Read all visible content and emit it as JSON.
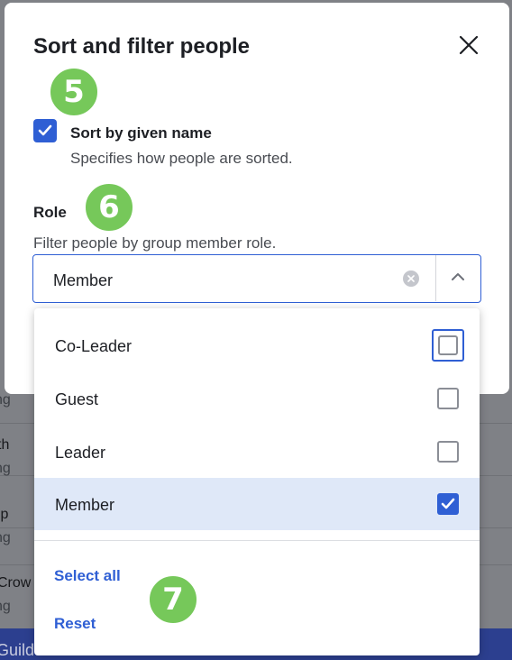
{
  "background": {
    "rows": [
      {
        "text": "ng",
        "sub": ""
      },
      {
        "text": "th",
        "sub": "ng"
      },
      {
        "text": "ip",
        "sub": "ng"
      },
      {
        "text": "Crow",
        "sub": "ng"
      }
    ],
    "footer_text": "Guild Crue"
  },
  "modal": {
    "title": "Sort and filter people",
    "sort": {
      "label": "Sort by given name",
      "help": "Specifies how people are sorted.",
      "checked": true
    },
    "role": {
      "label": "Role",
      "help": "Filter people by group member role.",
      "value": "Member"
    }
  },
  "dropdown": {
    "options": [
      {
        "label": "Co-Leader",
        "checked": false,
        "focused": true
      },
      {
        "label": "Guest",
        "checked": false
      },
      {
        "label": "Leader",
        "checked": false
      },
      {
        "label": "Member",
        "checked": true
      }
    ],
    "select_all_label": "Select all",
    "reset_label": "Reset"
  },
  "callouts": [
    "5",
    "6",
    "7"
  ],
  "colors": {
    "accent": "#2f5fd4",
    "callout": "#76c85a",
    "selected_row": "#dfe8f8"
  },
  "icons": [
    "close-icon",
    "check-icon",
    "clear-icon",
    "chevron-up-icon"
  ]
}
